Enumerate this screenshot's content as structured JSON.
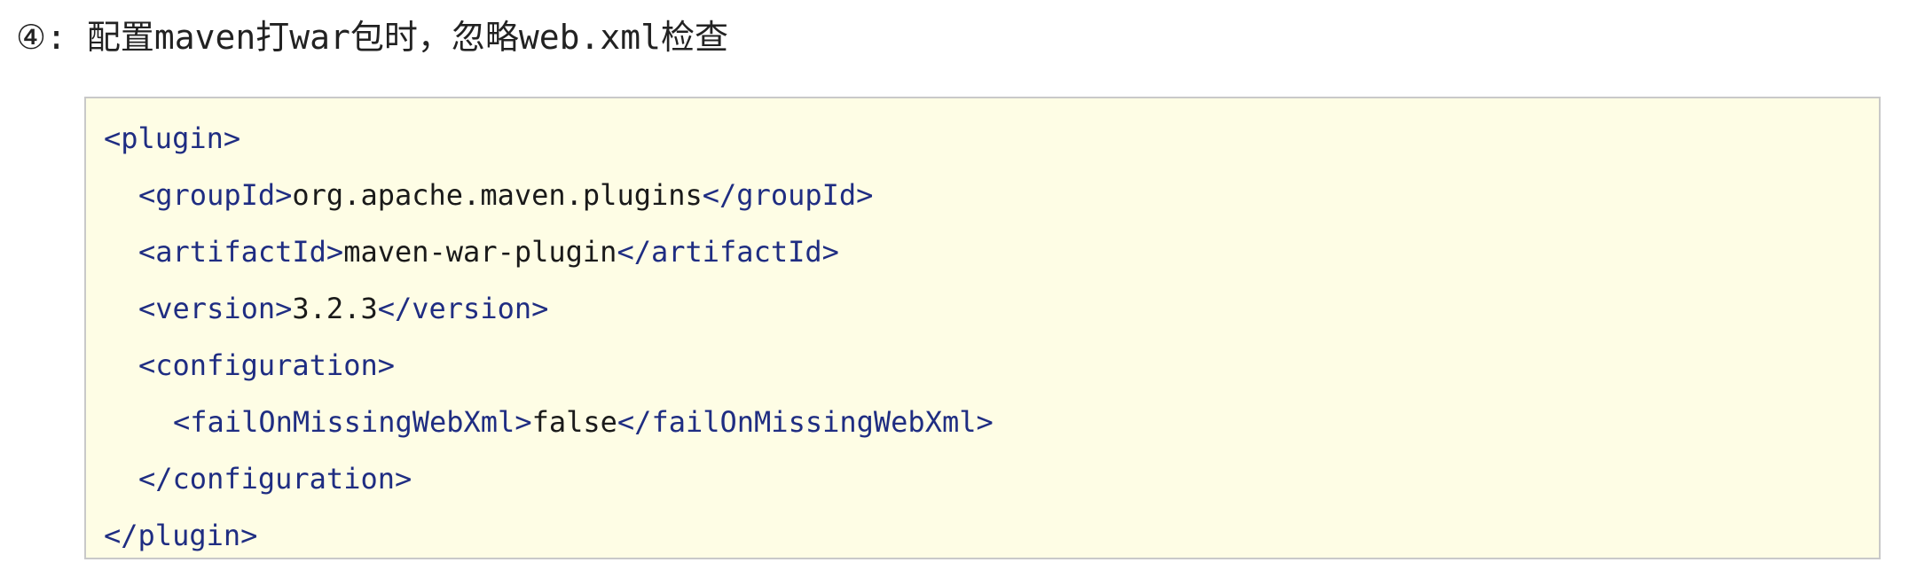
{
  "heading": {
    "text": "④: 配置maven打war包时，忽略web.xml检查"
  },
  "code": {
    "lines": [
      {
        "open": "<plugin>",
        "value": "",
        "close": ""
      },
      {
        "open": "<groupId>",
        "value": "org.apache.maven.plugins",
        "close": "</groupId>"
      },
      {
        "open": "<artifactId>",
        "value": "maven-war-plugin",
        "close": "</artifactId>"
      },
      {
        "open": "<version>",
        "value": "3.2.3",
        "close": "</version>"
      },
      {
        "open": "<configuration>",
        "value": "",
        "close": ""
      },
      {
        "open": "<failOnMissingWebXml>",
        "value": "false",
        "close": "</failOnMissingWebXml>"
      },
      {
        "open": "</configuration>",
        "value": "",
        "close": ""
      },
      {
        "open": "</plugin>",
        "value": "",
        "close": ""
      }
    ],
    "colors": {
      "background": "#fefde5",
      "border": "#c9c9c9",
      "tag": "#1f2d82",
      "text": "#1a1a1a"
    }
  }
}
